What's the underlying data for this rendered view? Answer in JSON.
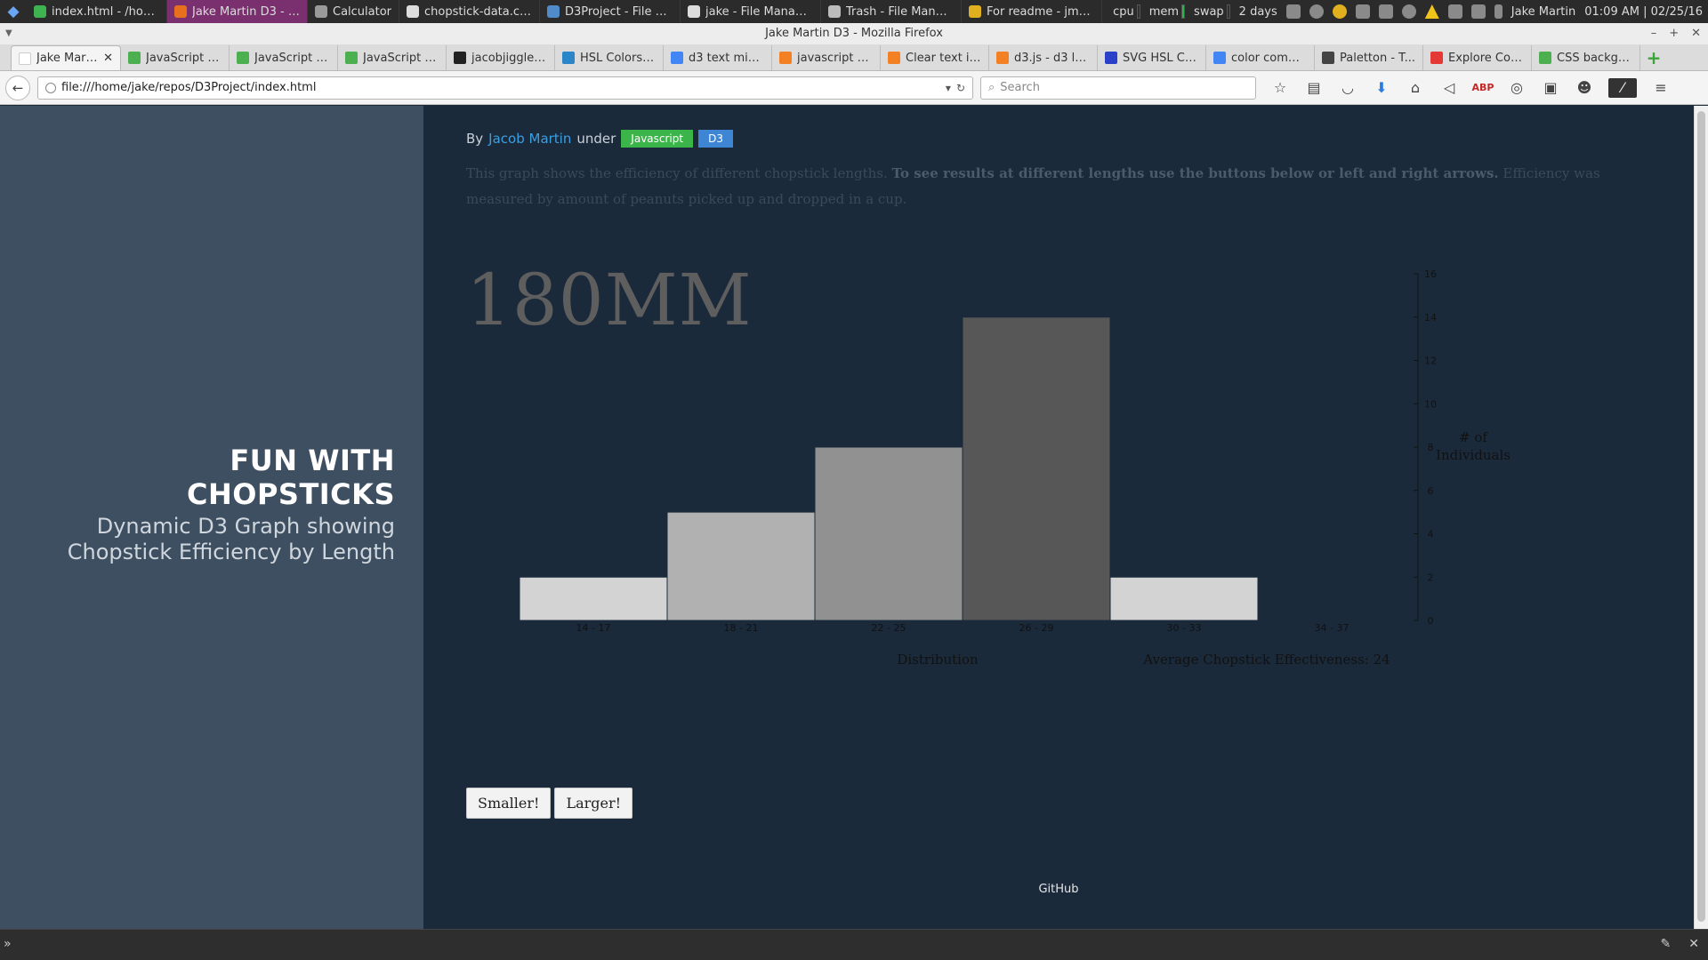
{
  "system_panel": {
    "tasks": [
      {
        "label": "index.html - /home...",
        "icon": "chrome-icon",
        "color": "#3fb34f"
      },
      {
        "label": "Jake Martin D3 - M...",
        "icon": "firefox-icon",
        "color": "#e76f1e",
        "active": true
      },
      {
        "label": "Calculator",
        "icon": "calculator-icon",
        "color": "#9a9a9a"
      },
      {
        "label": "chopstick-data.csv...",
        "icon": "text-editor-icon",
        "color": "#dddddd"
      },
      {
        "label": "D3Project - File Ma...",
        "icon": "folder-icon",
        "color": "#4f8cc9"
      },
      {
        "label": "jake - File Manager",
        "icon": "home-folder-icon",
        "color": "#dddddd"
      },
      {
        "label": "Trash - File Manager",
        "icon": "trash-icon",
        "color": "#bcbcbc"
      },
      {
        "label": "For readme - jmart...",
        "icon": "chrome-icon",
        "color": "#e0b01f"
      }
    ],
    "monitors": [
      "cpu",
      "mem",
      "swap"
    ],
    "uptime": "2 days",
    "user": "Jake Martin",
    "clock": "01:09 AM | 02/25/16"
  },
  "window": {
    "title": "Jake Martin D3 - Mozilla Firefox"
  },
  "tabs": [
    {
      "label": "Jake Martin D3",
      "icon": "page-icon",
      "color": "#ffffff",
      "active": true
    },
    {
      "label": "JavaScript f...",
      "icon": "w3schools-icon",
      "color": "#4caf50"
    },
    {
      "label": "JavaScript N...",
      "icon": "w3schools-icon",
      "color": "#4caf50"
    },
    {
      "label": "JavaScript S...",
      "icon": "w3schools-icon",
      "color": "#4caf50"
    },
    {
      "label": "jacobjiggler....",
      "icon": "github-icon",
      "color": "#222222"
    },
    {
      "label": "HSL Colors -...",
      "icon": "w3-icon",
      "color": "#2a86c8"
    },
    {
      "label": "d3 text miss...",
      "icon": "google-icon",
      "color": "#4285f4"
    },
    {
      "label": "javascript - ...",
      "icon": "stackoverflow-icon",
      "color": "#f48024"
    },
    {
      "label": "Clear text in...",
      "icon": "stackoverflow-icon",
      "color": "#f48024"
    },
    {
      "label": "d3.js - d3 le...",
      "icon": "stackoverflow-icon",
      "color": "#f48024"
    },
    {
      "label": "SVG HSL Col...",
      "icon": "d-icon",
      "color": "#2a40c8"
    },
    {
      "label": "color compl...",
      "icon": "google-icon",
      "color": "#4285f4"
    },
    {
      "label": "Paletton - T...",
      "icon": "paletton-icon",
      "color": "#444444"
    },
    {
      "label": "Explore Cor...",
      "icon": "explore-icon",
      "color": "#e53935"
    },
    {
      "label": "CSS backgr...",
      "icon": "w3schools-icon",
      "color": "#4caf50"
    }
  ],
  "navbar": {
    "url": "file:///home/jake/repos/D3Project/index.html",
    "search_placeholder": "Search"
  },
  "page": {
    "site_title": "FUN WITH CHOPSTICKS",
    "site_subtitle": "Dynamic D3 Graph showing Chopstick Efficiency by Length",
    "byline_prefix": "By",
    "author": "Jacob Martin",
    "byline_mid": "under",
    "tags": [
      "Javascript",
      "D3"
    ],
    "intro_part1": "This graph shows the efficiency of different chopstick lengths.",
    "intro_bold": "To see results at different lengths use the buttons below or left and right arrows.",
    "intro_part2": "Efficiency was measured by amount of peanuts picked up and dropped in a cup.",
    "length_label": "180MM",
    "smaller_button": "Smaller!",
    "larger_button": "Larger!",
    "github_link": "GitHub"
  },
  "chart_data": {
    "type": "bar",
    "categories": [
      "14 - 17",
      "18 - 21",
      "22 - 25",
      "26 - 29",
      "30 - 33",
      "34 - 37"
    ],
    "values": [
      2,
      5,
      8,
      14,
      2,
      0
    ],
    "bar_colors": [
      "#d3d3d3",
      "#b1b1b1",
      "#919191",
      "#575757",
      "#d3d3d3",
      "#d3d3d3"
    ],
    "yticks": [
      0,
      2,
      4,
      6,
      8,
      10,
      12,
      14,
      16
    ],
    "ylim": [
      0,
      16
    ],
    "xlabel": "Distribution",
    "ylabel_lines": [
      "# of",
      "Individuals"
    ],
    "summary": "Average Chopstick Effectiveness: 24"
  }
}
